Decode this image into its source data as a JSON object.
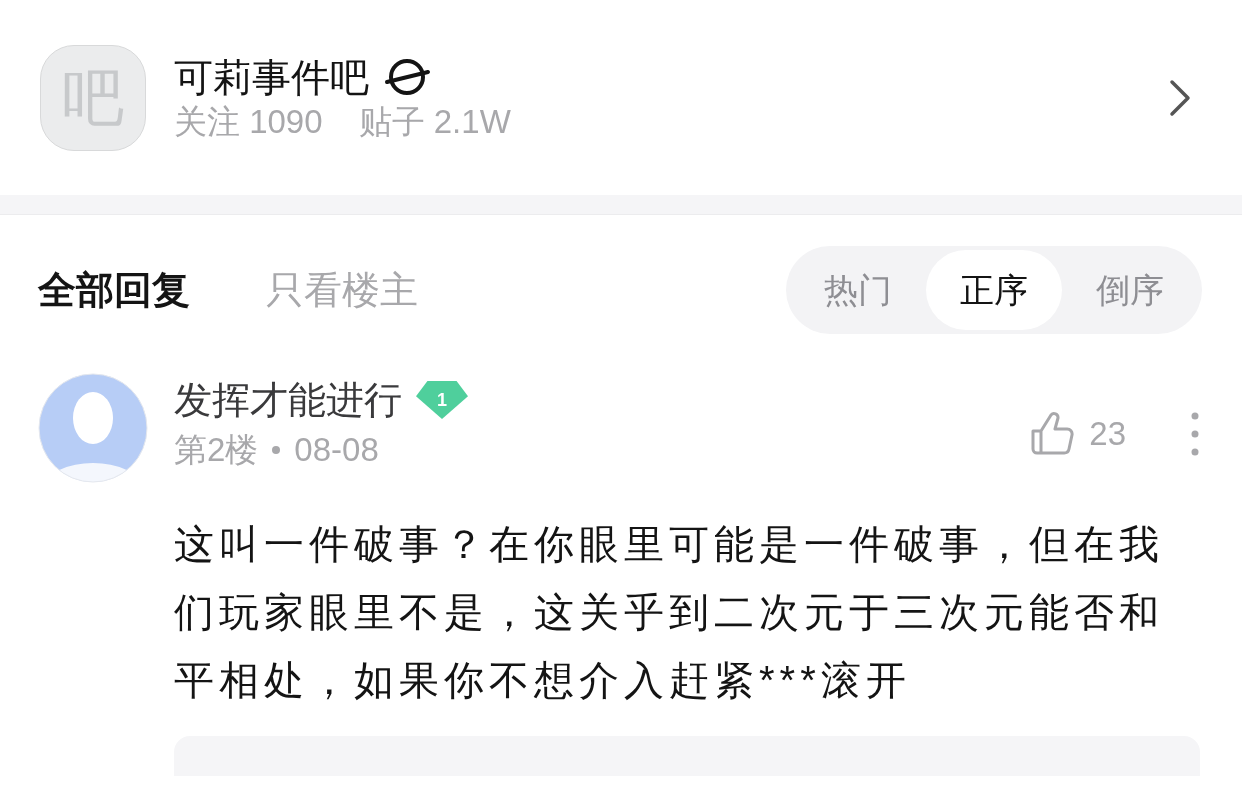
{
  "forum": {
    "avatar_glyph": "吧",
    "name": "可莉事件吧",
    "followers_label": "关注",
    "followers": "1090",
    "posts_label": "贴子",
    "posts": "2.1W"
  },
  "reply_tabs": [
    {
      "label": "全部回复",
      "selected": true
    },
    {
      "label": "只看楼主",
      "selected": false
    }
  ],
  "sort_options": [
    {
      "label": "热门",
      "selected": false
    },
    {
      "label": "正序",
      "selected": true
    },
    {
      "label": "倒序",
      "selected": false
    }
  ],
  "reply": {
    "username": "发挥才能进行",
    "level": "1",
    "floor": "第2楼",
    "date": "08-08",
    "likes": "23",
    "text": "这叫一件破事？在你眼里可能是一件破事，但在我们玩家眼里不是，这关乎到二次元于三次元能否和平相处，如果你不想介入赶紧***滚开"
  }
}
